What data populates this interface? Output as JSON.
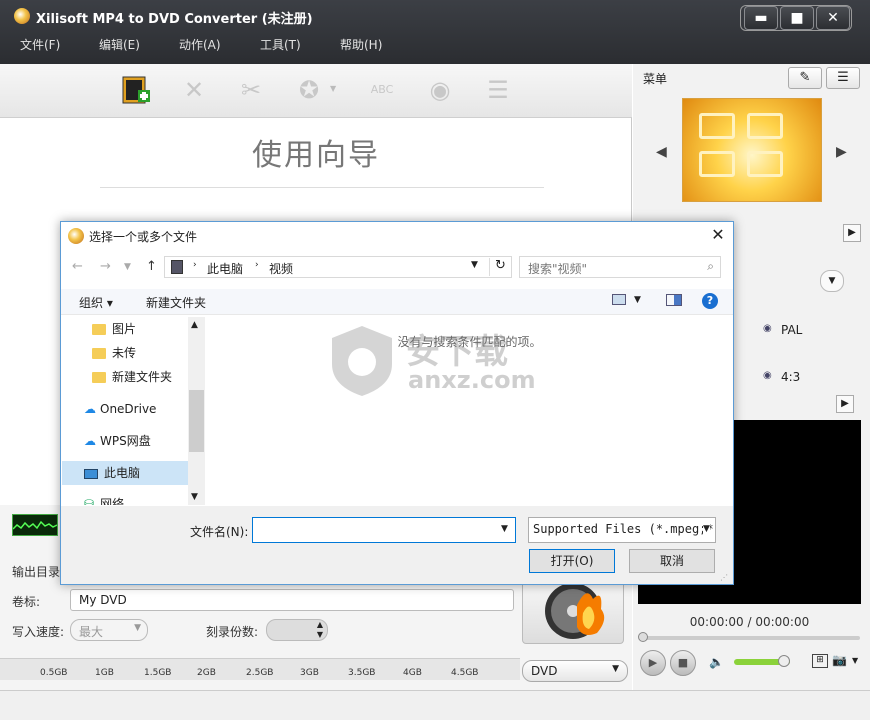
{
  "app": {
    "title": "Xilisoft MP4 to DVD Converter (未注册)"
  },
  "menubar": [
    "文件(F)",
    "编辑(E)",
    "动作(A)",
    "工具(T)",
    "帮助(H)"
  ],
  "window_buttons": {
    "minimize": "▬",
    "maximize": "■",
    "close": "✕"
  },
  "toolbar": {
    "icons": [
      "add-file-icon",
      "delete-icon",
      "cut-icon",
      "effects-icon",
      "subtitle-icon",
      "burn-disc-icon",
      "list-icon"
    ]
  },
  "main": {
    "guide_title": "使用向导"
  },
  "right_panel": {
    "menu_label": "菜单",
    "pal_label": "PAL",
    "ratio_label": "4:3",
    "time_readout": "00:00:00 / 00:00:00"
  },
  "bottom": {
    "output_dir_label": "输出目录",
    "volume_label_label": "卷标:",
    "volume_label_value": "My DVD",
    "speed_label": "写入速度:",
    "speed_value": "最大",
    "copies_label": "刻录份数:",
    "disc_type": "DVD",
    "scale_ticks": [
      "0.5GB",
      "1GB",
      "1.5GB",
      "2GB",
      "2.5GB",
      "3GB",
      "3.5GB",
      "4GB",
      "4.5GB"
    ]
  },
  "dialog": {
    "title": "选择一个或多个文件",
    "breadcrumb": [
      "此电脑",
      "视频"
    ],
    "search_placeholder": "搜索\"视频\"",
    "organize_label": "组织 ▾",
    "new_folder_label": "新建文件夹",
    "nav_items": [
      "图片",
      "未传",
      "新建文件夹",
      "OneDrive",
      "WPS网盘",
      "此电脑",
      "网络"
    ],
    "empty_message": "没有与搜索条件匹配的项。",
    "filename_label": "文件名(N):",
    "filename_value": "",
    "filetype_value": "Supported Files (*.mpeg;*.m",
    "open_button": "打开(O)",
    "cancel_button": "取消"
  },
  "watermark": {
    "text": "安下载",
    "sub": "anxz.com"
  }
}
